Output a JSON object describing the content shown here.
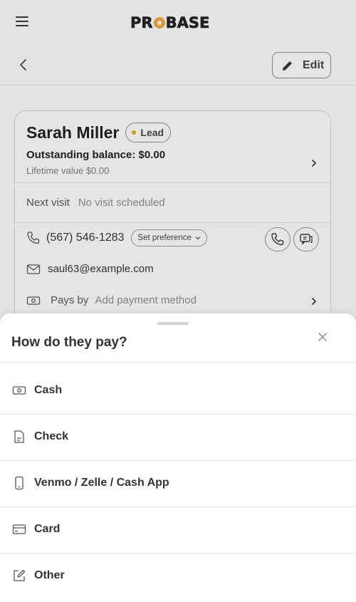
{
  "header": {
    "logo_text_pre": "PR",
    "logo_text_post": "BASE"
  },
  "nav": {
    "edit_label": "Edit"
  },
  "customer": {
    "name": "Sarah Miller",
    "status": "Lead",
    "status_color": "#e99a2f",
    "outstanding_balance": "Outstanding balance: $0.00",
    "lifetime_value": "Lifetime value $0.00",
    "next_visit_label": "Next visit",
    "next_visit_value": "No visit scheduled",
    "phone": "(567) 546-1283",
    "preference_label": "Set preference",
    "email": "saul63@example.com",
    "pays_by_label": "Pays by",
    "pays_by_value": "Add payment method"
  },
  "sheet": {
    "title": "How do they pay?",
    "options": [
      {
        "label": "Cash",
        "icon": "cash-icon"
      },
      {
        "label": "Check",
        "icon": "document-icon"
      },
      {
        "label": "Venmo / Zelle / Cash App",
        "icon": "phone-device-icon"
      },
      {
        "label": "Card",
        "icon": "credit-card-icon"
      },
      {
        "label": "Other",
        "icon": "pencil-square-icon"
      }
    ]
  }
}
